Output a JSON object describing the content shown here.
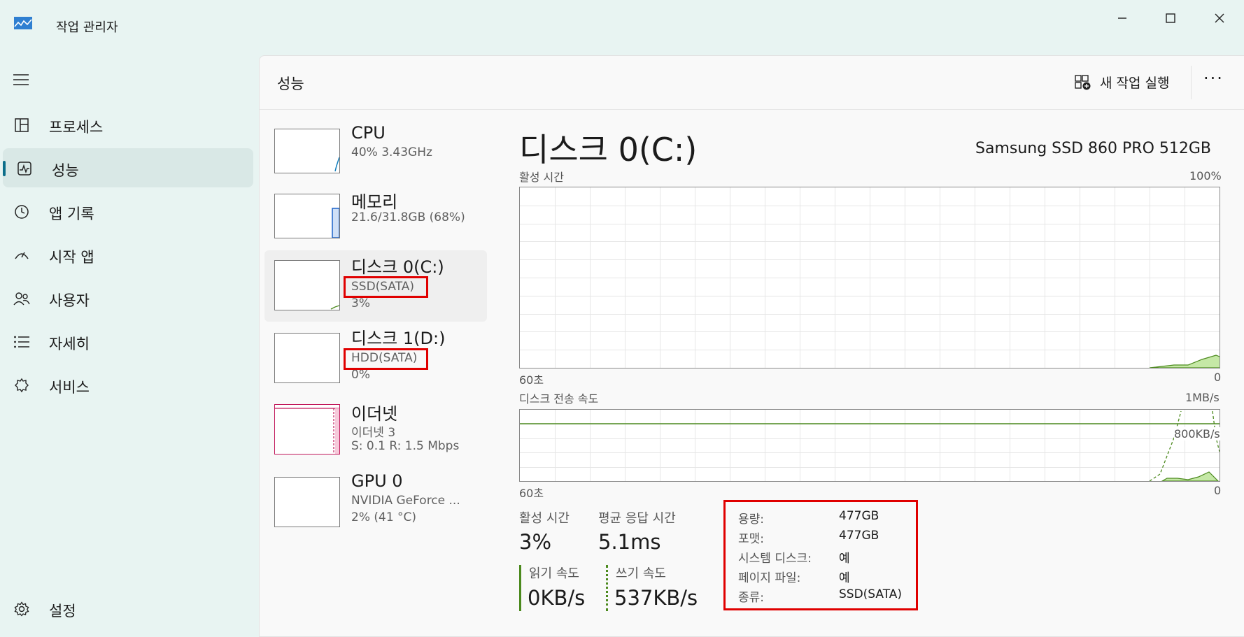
{
  "window": {
    "title": "작업 관리자",
    "controls": {
      "minimize": "—",
      "maximize": "☐",
      "close": "✕"
    }
  },
  "sidebar": {
    "menu_icon": "hamburger-icon",
    "items": [
      {
        "label": "프로세스",
        "icon": "processes-icon"
      },
      {
        "label": "성능",
        "icon": "performance-icon",
        "active": true
      },
      {
        "label": "앱 기록",
        "icon": "history-icon"
      },
      {
        "label": "시작 앱",
        "icon": "startup-icon"
      },
      {
        "label": "사용자",
        "icon": "users-icon"
      },
      {
        "label": "자세히",
        "icon": "details-icon"
      },
      {
        "label": "서비스",
        "icon": "services-icon"
      }
    ],
    "settings": {
      "label": "설정",
      "icon": "gear-icon"
    }
  },
  "header": {
    "title": "성능",
    "run_task": "새 작업 실행",
    "more": "···"
  },
  "devices": [
    {
      "name": "CPU",
      "line2": "40% 3.43GHz",
      "line3": ""
    },
    {
      "name": "메모리",
      "line2": "21.6/31.8GB (68%)",
      "line3": ""
    },
    {
      "name": "디스크 0(C:)",
      "line2": "SSD(SATA)",
      "line3": "3%",
      "selected": true
    },
    {
      "name": "디스크 1(D:)",
      "line2": "HDD(SATA)",
      "line3": "0%"
    },
    {
      "name": "이더넷",
      "line2": "이더넷 3",
      "line3": "S: 0.1  R: 1.5 Mbps"
    },
    {
      "name": "GPU 0",
      "line2": "NVIDIA GeForce ...",
      "line3": "2% (41 °C)"
    }
  ],
  "detail": {
    "title": "디스크 0(C:)",
    "model": "Samsung SSD 860 PRO 512GB",
    "graph1": {
      "label": "활성 시간",
      "max": "100%",
      "time": "60초",
      "min": "0"
    },
    "graph2": {
      "label": "디스크 전송 속도",
      "max": "1MB/s",
      "mid": "800KB/s",
      "time": "60초",
      "min": "0"
    },
    "stats": {
      "active_label": "활성 시간",
      "active_value": "3%",
      "resp_label": "평균 응답 시간",
      "resp_value": "5.1ms",
      "read_label": "읽기 속도",
      "read_value": "0KB/s",
      "write_label": "쓰기 속도",
      "write_value": "537KB/s"
    },
    "properties": [
      {
        "label": "용량:",
        "value": "477GB"
      },
      {
        "label": "포맷:",
        "value": "477GB"
      },
      {
        "label": "시스템 디스크:",
        "value": "예"
      },
      {
        "label": "페이지 파일:",
        "value": "예"
      },
      {
        "label": "종류:",
        "value": "SSD(SATA)"
      }
    ]
  },
  "colors": {
    "highlight": "#e00000",
    "disk_green": "#4c8a1e",
    "disk_fill": "#c5e8a6",
    "memory_blue": "#1c62c8",
    "ethernet_pink": "#c2185b",
    "cpu_teal": "#117dbb"
  }
}
